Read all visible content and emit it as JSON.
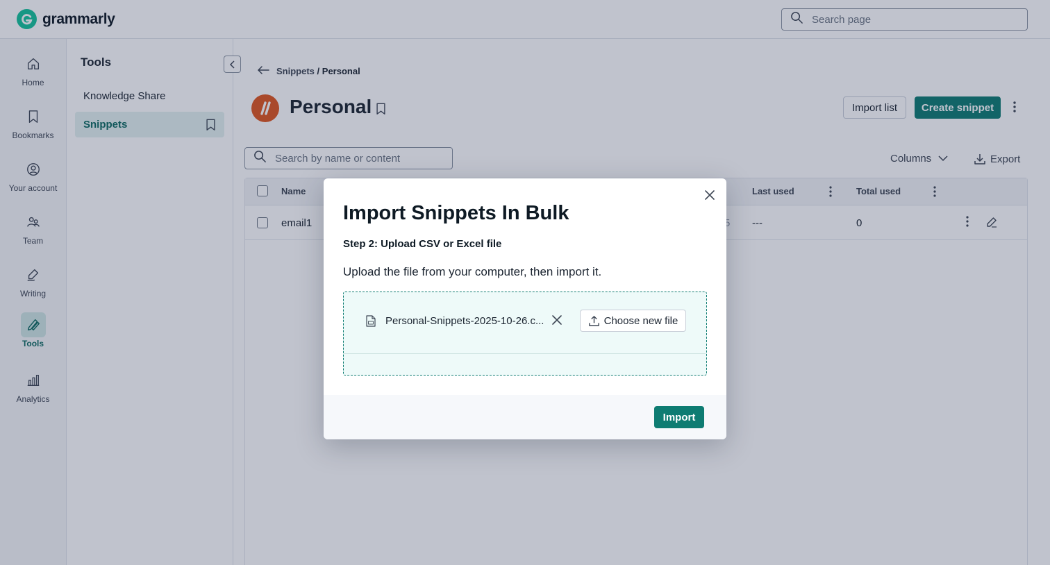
{
  "brand": {
    "name": "grammarly",
    "accent": "#0e7c72",
    "logo_color": "#15c39a"
  },
  "topbar": {
    "search_placeholder": "Search page"
  },
  "nav": {
    "items": [
      {
        "label": "Home",
        "icon": "home-icon"
      },
      {
        "label": "Bookmarks",
        "icon": "bookmark-icon"
      },
      {
        "label": "Your account",
        "icon": "account-icon"
      },
      {
        "label": "Team",
        "icon": "team-icon"
      },
      {
        "label": "Writing",
        "icon": "pen-icon"
      },
      {
        "label": "Tools",
        "icon": "tools-icon",
        "active": true
      },
      {
        "label": "Analytics",
        "icon": "analytics-icon"
      }
    ]
  },
  "tools_panel": {
    "title": "Tools",
    "items": [
      {
        "label": "Knowledge Share"
      },
      {
        "label": "Snippets",
        "active": true
      }
    ]
  },
  "main": {
    "breadcrumb": {
      "parent": "Snippets",
      "separator": "/",
      "current": "Personal"
    },
    "title": "Personal",
    "import_list_label": "Import list",
    "create_label": "Create snippet",
    "search_placeholder": "Search by name or content",
    "columns_label": "Columns",
    "export_label": "Export",
    "table": {
      "headers": {
        "name": "Name",
        "last_used": "Last used",
        "total_used": "Total used"
      },
      "rows": [
        {
          "name": "email1",
          "hidden_partial": "5",
          "last_used": "---",
          "total_used": "0"
        }
      ]
    }
  },
  "modal": {
    "title": "Import Snippets In Bulk",
    "step": "Step 2: Upload CSV or Excel file",
    "description": "Upload the file from your computer, then import it.",
    "file_name": "Personal-Snippets-2025-10-26.c...",
    "choose_label": "Choose new file",
    "import_label": "Import"
  }
}
